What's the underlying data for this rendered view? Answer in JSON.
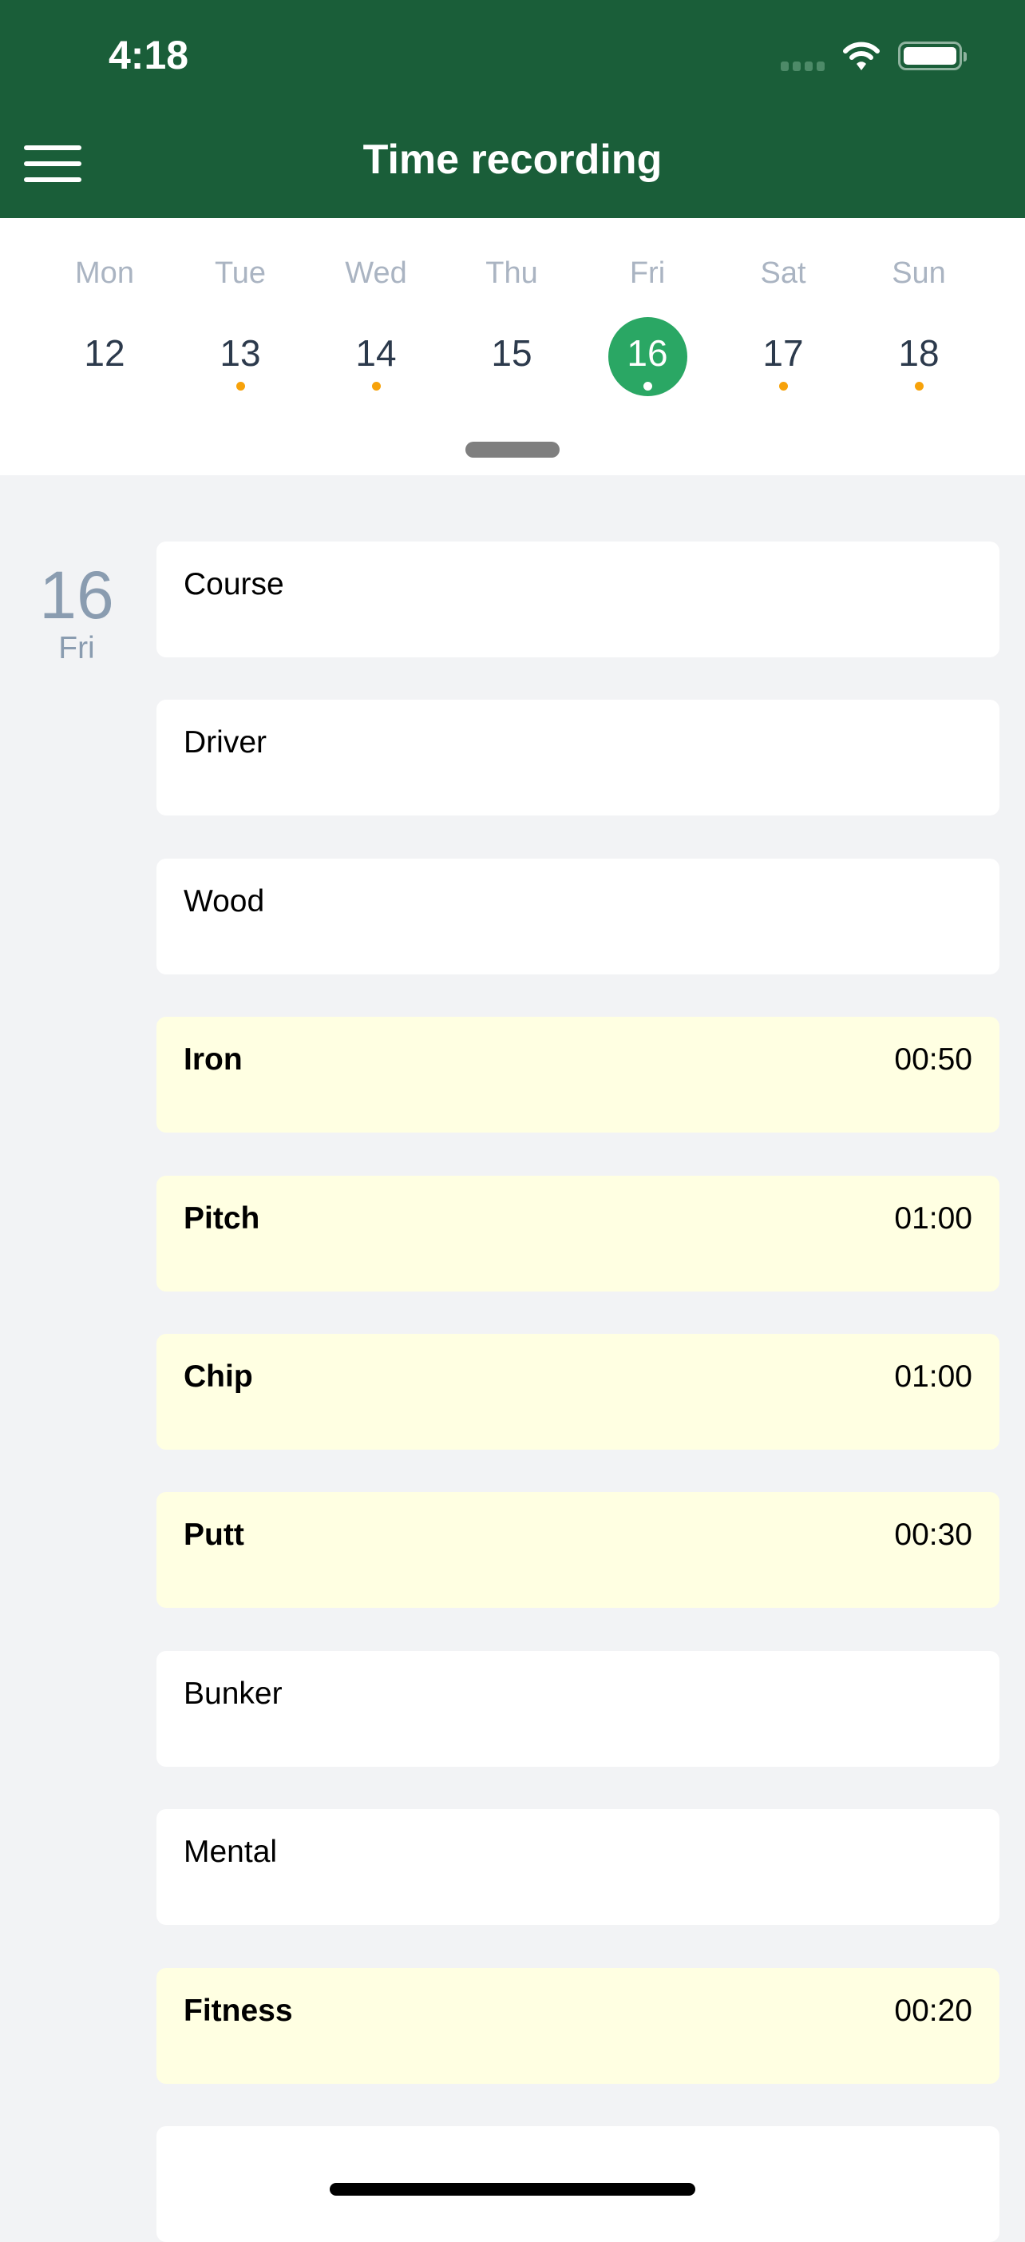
{
  "status_bar": {
    "time": "4:18"
  },
  "header": {
    "title": "Time recording",
    "menu_icon": "hamburger-menu-icon"
  },
  "week": [
    {
      "day": "Mon",
      "date": "12",
      "has_entries": false,
      "selected": false
    },
    {
      "day": "Tue",
      "date": "13",
      "has_entries": true,
      "selected": false
    },
    {
      "day": "Wed",
      "date": "14",
      "has_entries": true,
      "selected": false
    },
    {
      "day": "Thu",
      "date": "15",
      "has_entries": false,
      "selected": false
    },
    {
      "day": "Fri",
      "date": "16",
      "has_entries": true,
      "selected": true
    },
    {
      "day": "Sat",
      "date": "17",
      "has_entries": true,
      "selected": false
    },
    {
      "day": "Sun",
      "date": "18",
      "has_entries": true,
      "selected": false
    }
  ],
  "selected_day": {
    "date": "16",
    "day": "Fri"
  },
  "entries": [
    {
      "label": "Course",
      "duration": ""
    },
    {
      "label": "Driver",
      "duration": ""
    },
    {
      "label": "Wood",
      "duration": ""
    },
    {
      "label": "Iron",
      "duration": "00:50"
    },
    {
      "label": "Pitch",
      "duration": "01:00"
    },
    {
      "label": "Chip",
      "duration": "01:00"
    },
    {
      "label": "Putt",
      "duration": "00:30"
    },
    {
      "label": "Bunker",
      "duration": ""
    },
    {
      "label": "Mental",
      "duration": ""
    },
    {
      "label": "Fitness",
      "duration": "00:20"
    },
    {
      "label": "",
      "duration": ""
    }
  ],
  "colors": {
    "header": "#1a5e39",
    "selected": "#2aa764",
    "entry_dot": "#f7a20a",
    "recorded_card": "#ffffe2"
  }
}
